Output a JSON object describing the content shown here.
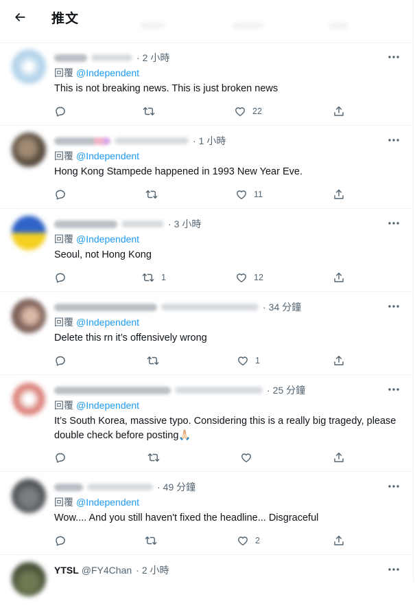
{
  "header": {
    "title": "推文"
  },
  "tweets": [
    {
      "author_name": "",
      "author_handle": "",
      "time": "2 小時",
      "replying_label": "回覆",
      "replying_to": "@Independent",
      "text": "This is not breaking news. This is just broken news",
      "replies": "",
      "retweets": "",
      "likes": "22"
    },
    {
      "author_name": "",
      "author_handle": "",
      "time": "1 小時",
      "replying_label": "回覆",
      "replying_to": "@Independent",
      "text": "Hong Kong Stampede happened in 1993 New Year Eve.",
      "replies": "",
      "retweets": "",
      "likes": "11"
    },
    {
      "author_name": "",
      "author_handle": "",
      "time": "3 小時",
      "replying_label": "回覆",
      "replying_to": "@Independent",
      "text": "Seoul, not Hong Kong",
      "replies": "",
      "retweets": "1",
      "likes": "12"
    },
    {
      "author_name": "",
      "author_handle": "",
      "time": "34 分鐘",
      "replying_label": "回覆",
      "replying_to": "@Independent",
      "text": "Delete this rn it’s offensively wrong",
      "replies": "",
      "retweets": "",
      "likes": "1"
    },
    {
      "author_name": "",
      "author_handle": "",
      "time": "25 分鐘",
      "replying_label": "回覆",
      "replying_to": "@Independent",
      "text": "It’s South Korea, massive typo. Considering this is a really big tragedy, please double check before posting🙏🏻",
      "replies": "",
      "retweets": "",
      "likes": ""
    },
    {
      "author_name": "",
      "author_handle": "",
      "time": "49 分鐘",
      "replying_label": "回覆",
      "replying_to": "@Independent",
      "text": "Wow.... And you still haven't fixed the headline... Disgraceful",
      "replies": "",
      "retweets": "",
      "likes": "2"
    },
    {
      "author_name": "YTSL",
      "author_handle": "@FY4Chan",
      "time": "2 小時",
      "replying_label": "",
      "replying_to": "",
      "text": "",
      "replies": "",
      "retweets": "",
      "likes": ""
    }
  ],
  "icons": {
    "back": "arrow-left-icon",
    "more": "more-dots-icon",
    "reply": "reply-icon",
    "retweet": "retweet-icon",
    "like": "heart-icon",
    "share": "share-icon"
  },
  "colors": {
    "text": "#0f1419",
    "secondary": "#536471",
    "link": "#1d9bf0",
    "divider": "#eff3f4"
  }
}
